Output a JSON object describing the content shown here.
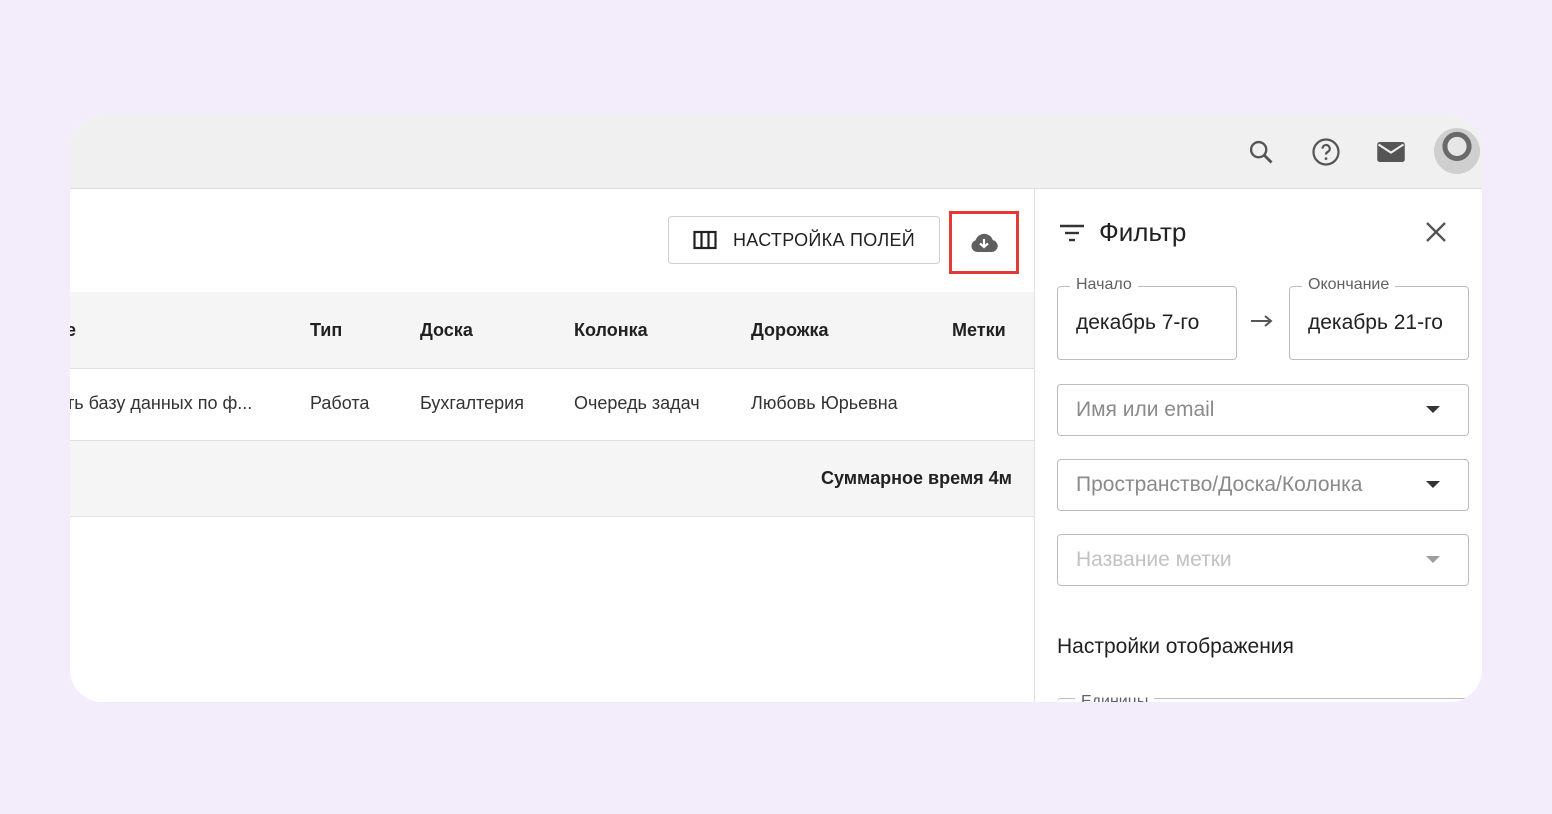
{
  "header": {
    "icons": [
      "search-icon",
      "help-icon",
      "mail-icon",
      "avatar"
    ]
  },
  "toolbar": {
    "fields_button_label": "НАСТРОЙКА ПОЛЕЙ",
    "download_icon": "cloud-download-icon"
  },
  "table": {
    "columns": [
      "е",
      "Тип",
      "Доска",
      "Колонка",
      "Дорожка",
      "Метки"
    ],
    "rows": [
      [
        "ть базу данных по ф...",
        "Работа",
        "Бухгалтерия",
        "Очередь задач",
        "Любовь Юрьевна",
        ""
      ]
    ],
    "total_label": "Суммарное время 4м"
  },
  "filter_panel": {
    "title": "Фильтр",
    "start_label": "Начало",
    "start_value": "декабрь 7-го",
    "end_label": "Окончание",
    "end_value": "декабрь 21-го",
    "name_placeholder": "Имя или email",
    "space_placeholder": "Пространство/Доска/Колонка",
    "tag_placeholder": "Название метки",
    "display_settings_title": "Настройки отображения",
    "units_label": "Единицы"
  },
  "colors": {
    "page_bg": "#f3ecfb",
    "highlight": "#e53935"
  }
}
